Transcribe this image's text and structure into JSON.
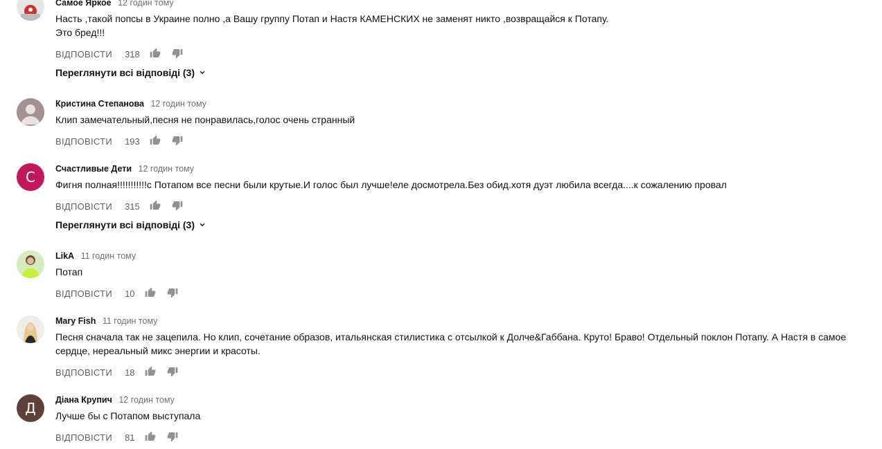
{
  "comments": [
    {
      "author": "Самое Яркое",
      "time": "12 годин тому",
      "lines": [
        "Насть ,такой попсы в Украине полно ,а Вашу группу Потап и Настя КАМЕНСКИХ  не заменят никто ,возвращайся к Потапу.",
        "Это бред!!!"
      ],
      "likes": "318",
      "reply_label": "ВІДПОВІСТИ",
      "view_replies": "Переглянути всі відповіді (3)",
      "avatar_icon": "photo-avatar-icon"
    },
    {
      "author": "Кристина Степанова",
      "time": "12 годин тому",
      "lines": [
        "Клип замечательный,песня не понравилась,голос очень странный"
      ],
      "likes": "193",
      "reply_label": "ВІДПОВІСТИ",
      "avatar_icon": "default-user-avatar-icon"
    },
    {
      "author": "Счастливые Дети",
      "time": "12 годин тому",
      "lines": [
        "Фигня полная!!!!!!!!!!!с Потапом все песни были крутые.И голос был лучше!еле досмотрела.Без обид.хотя дуэт любила всегда....к сожалению провал"
      ],
      "likes": "315",
      "reply_label": "ВІДПОВІСТИ",
      "view_replies": "Переглянути всі відповіді (3)",
      "avatar_letter": "С",
      "avatar_color": "#c2185b"
    },
    {
      "author": "LikA",
      "time": "11 годин тому",
      "lines": [
        "Потап"
      ],
      "likes": "10",
      "reply_label": "ВІДПОВІСТИ",
      "avatar_icon": "photo-avatar-icon"
    },
    {
      "author": "Mary Fish",
      "time": "11 годин тому",
      "lines": [
        "Песня сначала так не зацепила. Но клип, сочетание образов, итальянская стилистика с отсылкой к Долче&Габбана. Круто! Браво! Отдельный поклон Потапу. А Настя в самое",
        "сердце, нереальный микс энергии и красоты."
      ],
      "likes": "18",
      "reply_label": "ВІДПОВІСТИ",
      "avatar_icon": "photo-avatar-icon"
    },
    {
      "author": "Діана Крупич",
      "time": "12 годин тому",
      "lines": [
        "Лучше бы с Потапом выступала"
      ],
      "likes": "81",
      "reply_label": "ВІДПОВІСТИ",
      "avatar_letter": "Д",
      "avatar_color": "#5d4037"
    }
  ],
  "icons": {
    "like": "thumb-up-icon",
    "dislike": "thumb-down-icon",
    "expand": "chevron-down-icon"
  }
}
